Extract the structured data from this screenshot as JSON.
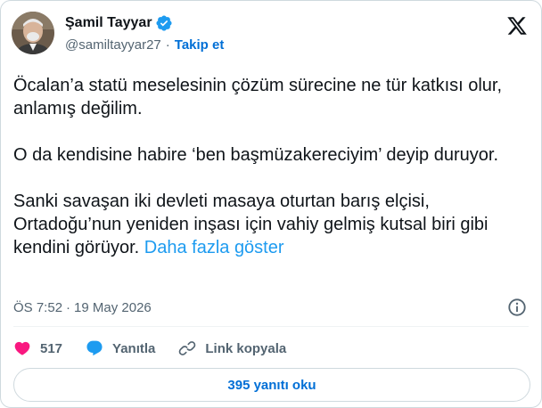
{
  "author": {
    "name": "Şamil Tayyar",
    "handle": "@samiltayyar27",
    "separator": "·",
    "follow_label": "Takip et"
  },
  "tweet": {
    "paragraphs": [
      "Öcalan’a statü meselesinin çözüm sürecine ne tür katkısı olur, anlamış değilim.",
      "O da kendisine habire ‘ben başmüzakereciyim’ deyip duruyor.",
      "Sanki savaşan iki devleti masaya oturtan barış elçisi, Ortadoğu’nun yeniden inşası için vahiy gelmiş kutsal biri gibi kendini görüyor."
    ],
    "show_more": "Daha fazla göster"
  },
  "meta": {
    "time": "ÖS 7:52",
    "separator": "·",
    "date": "19 May 2026"
  },
  "actions": {
    "likes": "517",
    "reply_label": "Yanıtla",
    "copy_link_label": "Link kopyala"
  },
  "read_replies": "395 yanıtı oku",
  "icons": {
    "verified": "verified-badge-icon",
    "logo": "x-logo-icon",
    "info": "info-icon",
    "like": "heart-icon",
    "reply": "speech-bubble-icon",
    "link": "link-icon"
  },
  "colors": {
    "accent": "#1d9bf0",
    "follow": "#006fd6",
    "heart": "#f91880",
    "text": "#0f1419",
    "muted": "#536471"
  }
}
